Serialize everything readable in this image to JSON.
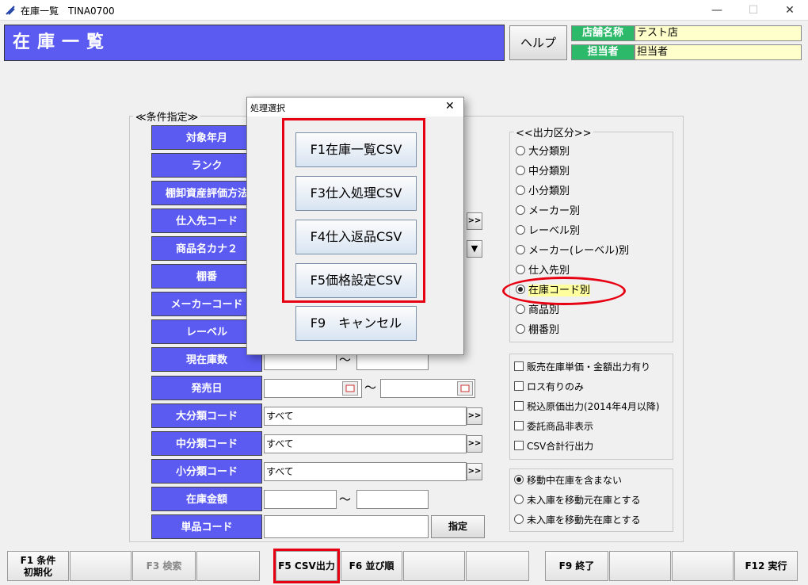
{
  "window": {
    "title": "在庫一覧　TINA0700",
    "min": "—",
    "max": "☐",
    "close": "✕"
  },
  "header": {
    "title": "在庫一覧",
    "help": "ヘルプ",
    "store_label": "店舗名称",
    "store_value": "テスト店",
    "staff_label": "担当者",
    "staff_value": "担当者"
  },
  "conditions": {
    "title": "≪条件指定≫",
    "fields": {
      "target_month": "対象年月",
      "rank": "ランク",
      "valuation": "棚卸資産評価方法",
      "supplier_code": "仕入先コード",
      "product_kana": "商品名カナ２",
      "shelf": "棚番",
      "maker_code": "メーカーコード",
      "level": "レーベル",
      "stock_qty": "現在庫数",
      "release_date": "発売日",
      "major_code": "大分類コード",
      "mid_code": "中分類コード",
      "minor_code": "小分類コード",
      "stock_amount": "在庫金額",
      "item_code": "単品コード"
    },
    "major_value": "すべて",
    "mid_value": "すべて",
    "minor_value": "すべて",
    "tilde": "〜",
    "more": ">>",
    "dropdown": "▼",
    "specify": "指定"
  },
  "output": {
    "title": "<<出力区分>>",
    "options": [
      "大分類別",
      "中分類別",
      "小分類別",
      "メーカー別",
      "レーベル別",
      "メーカー(レーベル)別",
      "仕入先別",
      "在庫コード別",
      "商品別",
      "棚番別"
    ],
    "selected": "在庫コード別"
  },
  "checks": [
    "販売在庫単価・金額出力有り",
    "ロス有りのみ",
    "税込原価出力(2014年4月以降)",
    "委託商品非表示",
    "CSV合計行出力"
  ],
  "transit": {
    "options": [
      "移動中在庫を含まない",
      "未入庫を移動元在庫とする",
      "未入庫を移動先在庫とする"
    ],
    "selected": "移動中在庫を含まない"
  },
  "dialog": {
    "title": "処理選択",
    "close": "✕",
    "buttons": [
      "F1在庫一覧CSV",
      "F3仕入処理CSV",
      "F4仕入返品CSV",
      "F5価格設定CSV",
      "F9　キャンセル"
    ]
  },
  "footer": {
    "f1_line1": "F1 条件",
    "f1_line2": "初期化",
    "f3": "F3 検索",
    "f5": "F5 CSV出力",
    "f6": "F6 並び順",
    "f9": "F9 終了",
    "f12": "F12 実行"
  },
  "colors": {
    "header_blue": "#5b5bf2",
    "label_green": "#2db96a",
    "highlight_red": "#e60012",
    "value_yellow": "#ffffcc"
  }
}
